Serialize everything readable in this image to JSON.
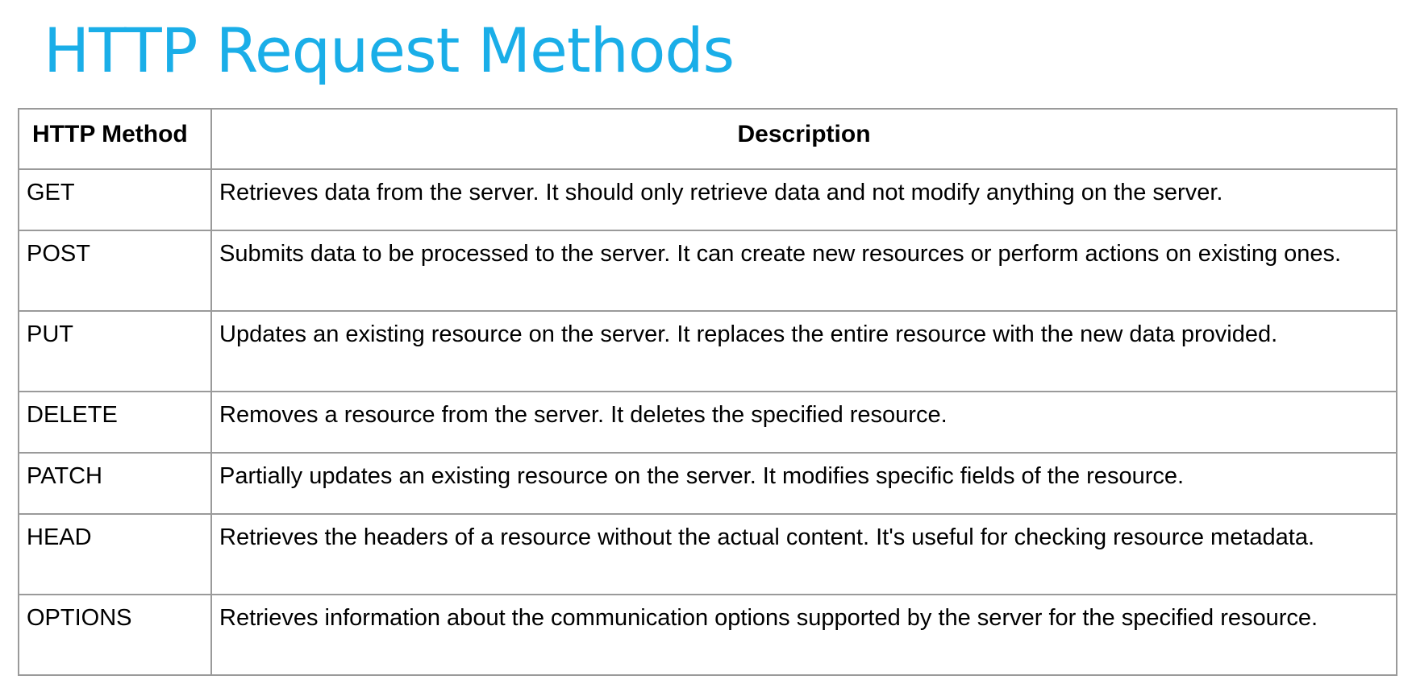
{
  "slide": {
    "title": "HTTP Request Methods"
  },
  "table": {
    "headers": {
      "method": "HTTP Method",
      "description": "Description"
    },
    "rows": [
      {
        "method": "GET",
        "description": "Retrieves data from the server. It should only retrieve data and not modify anything on the server."
      },
      {
        "method": "POST",
        "description": "Submits data to be processed to the server. It can create new resources or perform actions on existing ones."
      },
      {
        "method": "PUT",
        "description": "Updates an existing resource on the server. It replaces the entire resource with the new data provided."
      },
      {
        "method": "DELETE",
        "description": "Removes a resource from the server. It deletes the specified resource."
      },
      {
        "method": "PATCH",
        "description": "Partially updates an existing resource on the server. It modifies specific fields of the resource."
      },
      {
        "method": "HEAD",
        "description": "Retrieves the headers of a resource without the actual content. It's useful for checking resource metadata."
      },
      {
        "method": "OPTIONS",
        "description": "Retrieves information about the communication options supported by the server for the specified resource."
      }
    ]
  },
  "colors": {
    "title": "#1AAEE8",
    "border": "#9A9A9A",
    "text": "#000000",
    "background": "#FFFFFF"
  }
}
